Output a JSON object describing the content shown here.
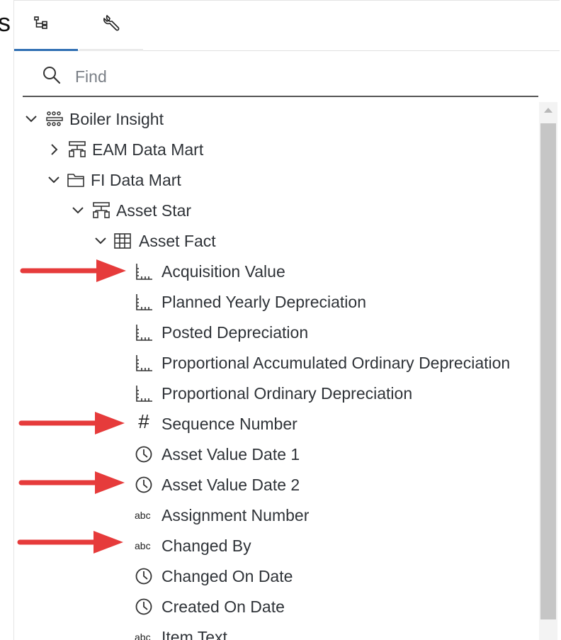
{
  "edge_fragment": "s",
  "tabs": [
    {
      "name": "data-tree",
      "icon": "tree-structure-icon",
      "active": true
    },
    {
      "name": "tools",
      "icon": "wrench-icon",
      "active": false
    }
  ],
  "search": {
    "placeholder": "Find",
    "value": ""
  },
  "colors": {
    "accent": "#2f6fb3",
    "arrow": "#e63b3b",
    "text": "#2f3338"
  },
  "tree": {
    "root": {
      "label": "Boiler Insight",
      "icon": "package-icon",
      "expanded": true
    },
    "eam": {
      "label": "EAM Data Mart",
      "icon": "star-schema-icon",
      "expanded": false
    },
    "fi": {
      "label": "FI Data Mart",
      "icon": "folder-icon",
      "expanded": true
    },
    "asset_star": {
      "label": "Asset Star",
      "icon": "star-schema-icon",
      "expanded": true
    },
    "asset_fact": {
      "label": "Asset Fact",
      "icon": "table-icon",
      "expanded": true
    },
    "columns": [
      {
        "label": "Acquisition Value",
        "icon": "measure-icon"
      },
      {
        "label": "Planned Yearly Depreciation",
        "icon": "measure-icon"
      },
      {
        "label": "Posted Depreciation",
        "icon": "measure-icon"
      },
      {
        "label": "Proportional Accumulated Ordinary Depreciation",
        "icon": "measure-icon"
      },
      {
        "label": "Proportional Ordinary Depreciation",
        "icon": "measure-icon"
      },
      {
        "label": "Sequence Number",
        "icon": "number-icon"
      },
      {
        "label": "Asset Value Date 1",
        "icon": "clock-icon"
      },
      {
        "label": "Asset Value Date 2",
        "icon": "clock-icon"
      },
      {
        "label": "Assignment Number",
        "icon": "text-icon"
      },
      {
        "label": "Changed By",
        "icon": "text-icon"
      },
      {
        "label": "Changed On Date",
        "icon": "clock-icon"
      },
      {
        "label": "Created On Date",
        "icon": "clock-icon"
      },
      {
        "label": "Item Text",
        "icon": "text-icon"
      }
    ],
    "number_glyph": "#",
    "text_glyph": "abc"
  },
  "annotations": {
    "arrows": [
      {
        "points_to": "Acquisition Value",
        "icon": "red-arrow-icon"
      },
      {
        "points_to": "Sequence Number",
        "icon": "red-arrow-icon"
      },
      {
        "points_to": "Asset Value Date 2",
        "icon": "red-arrow-icon"
      },
      {
        "points_to": "Changed By",
        "icon": "red-arrow-icon"
      }
    ]
  }
}
